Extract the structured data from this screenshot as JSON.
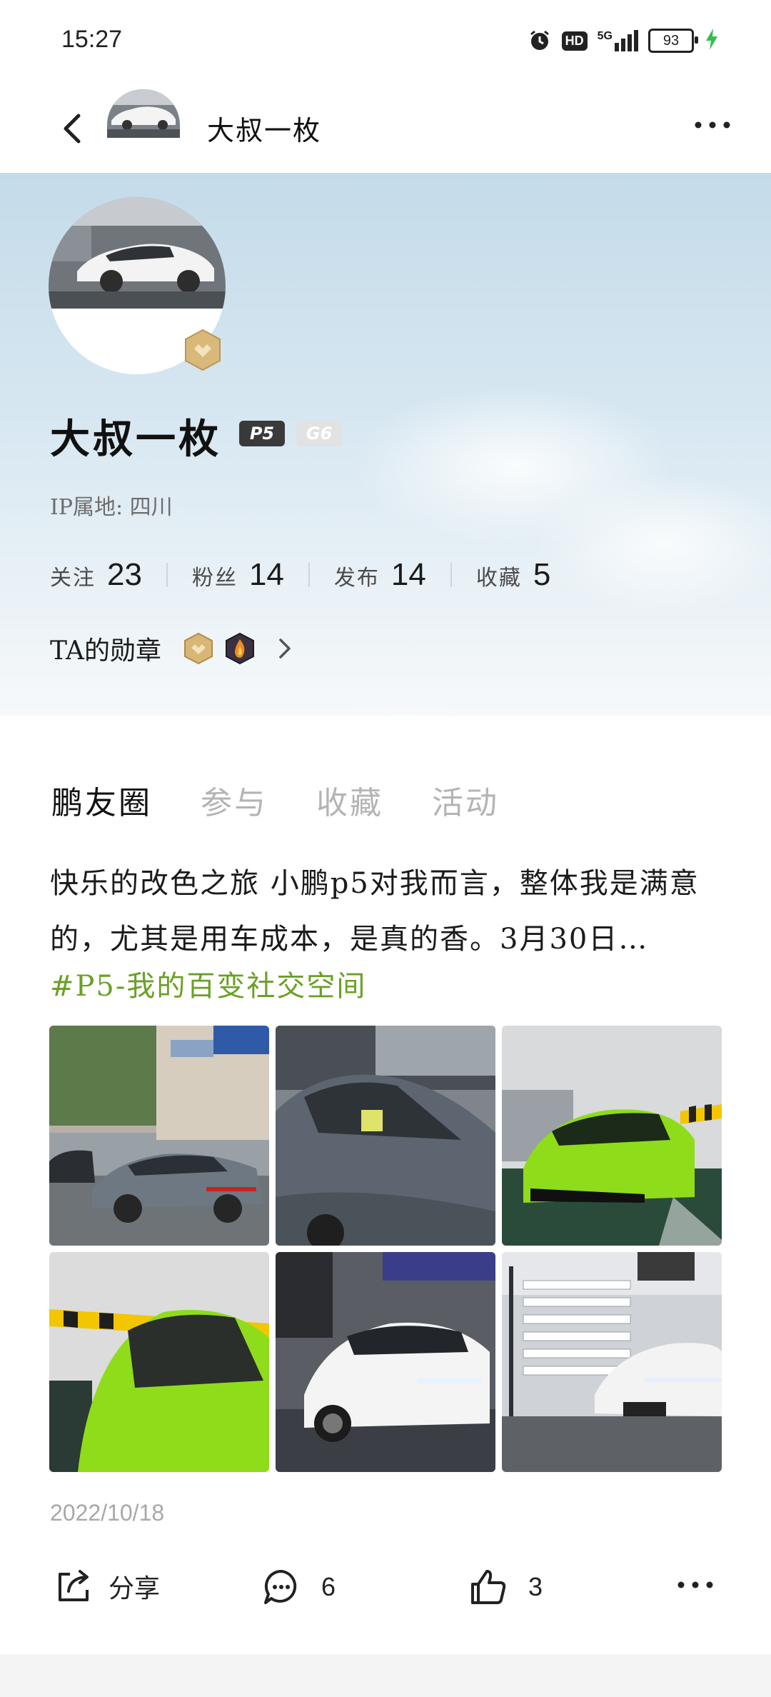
{
  "status_bar": {
    "time": "15:27",
    "network": "5G",
    "hd": "HD",
    "battery": "93"
  },
  "header": {
    "title": "大叔一枚"
  },
  "profile": {
    "name": "大叔一枚",
    "tags": [
      "P5",
      "G6"
    ],
    "ip": "IP属地: 四川",
    "stats": [
      {
        "label": "关注",
        "value": "23"
      },
      {
        "label": "粉丝",
        "value": "14"
      },
      {
        "label": "发布",
        "value": "14"
      },
      {
        "label": "收藏",
        "value": "5"
      }
    ],
    "medals_label": "TA的勋章"
  },
  "tabs": [
    "鹏友圈",
    "参与",
    "收藏",
    "活动"
  ],
  "post": {
    "text": "快乐的改色之旅 小鹏p5对我而言，整体我是满意的，尤其是用车成本，是真的香。3月30日…",
    "hashtag": "#P5-我的百变社交空间",
    "date": "2022/10/18",
    "actions": {
      "share_label": "分享",
      "comments": "6",
      "likes": "3"
    }
  },
  "colors": {
    "hashtag": "#6aa026",
    "tab_inactive": "#b4b4b4",
    "charge": "#2fbf4f"
  }
}
